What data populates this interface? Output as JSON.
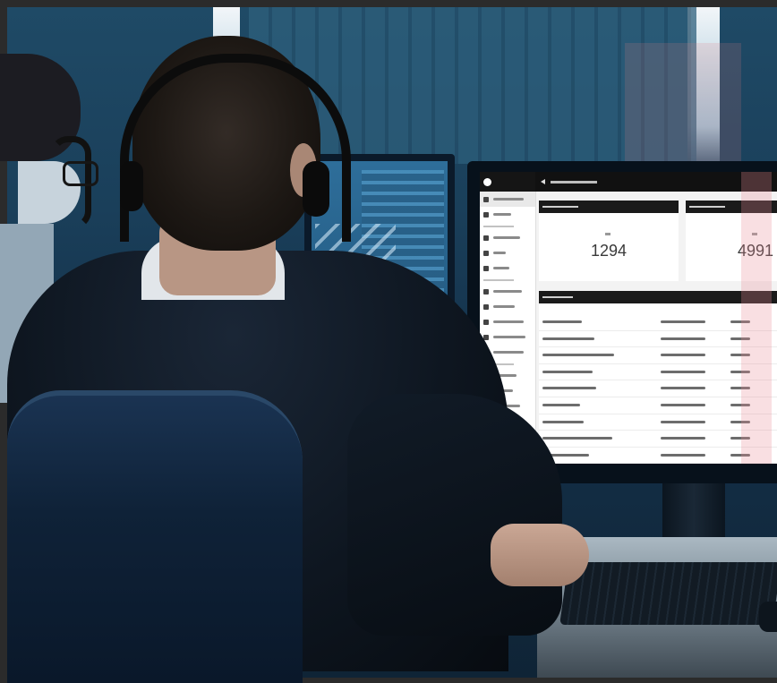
{
  "monitor_app": {
    "logo": "",
    "header_title": "",
    "cards": [
      {
        "label": "",
        "value": "1294"
      },
      {
        "label": "",
        "value": "4991"
      }
    ],
    "table": {
      "title": "",
      "row_count": 10
    }
  },
  "colors": {
    "background": "#2b2b2b",
    "room_blue": "#1a3f5a",
    "screen_bg": "#f3f3f3",
    "header_dark": "#111111"
  }
}
